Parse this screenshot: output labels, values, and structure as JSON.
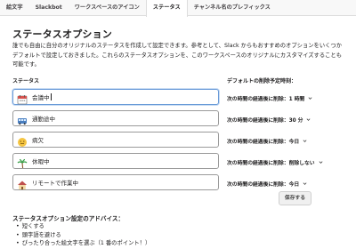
{
  "tabs": [
    "絵文字",
    "Slackbot",
    "ワークスペースのアイコン",
    "ステータス",
    "チャンネル名のプレフィックス"
  ],
  "page_title": "ステータスオプション",
  "description": "誰でも自由に自分のオリジナルのステータスを作成して設定できます。参考として、Slack からもおすすめのオプションをいくつかデフォルトで設定しておきました。これらのステータスオプションを、このワークスペースのオリジナルにカスタマイズすることも可能です。",
  "columns": {
    "status": "ステータス",
    "default_expiry": "デフォルトの削除予定時刻："
  },
  "expiry_prefix": "次の時間の経過後に削除：",
  "statuses": [
    {
      "emoji": "calendar-emoji",
      "text": "会議中",
      "expiry": "1 時間"
    },
    {
      "emoji": "bus-emoji",
      "text": "通勤途中",
      "expiry": "30 分"
    },
    {
      "emoji": "face-with-thermometer-emoji",
      "text": "病欠",
      "expiry": "今日"
    },
    {
      "emoji": "palm-tree-emoji",
      "text": "休暇中",
      "expiry": "削除しない"
    },
    {
      "emoji": "house-emoji",
      "text": "リモートで作業中",
      "expiry": "今日"
    }
  ],
  "save_label": "保存する",
  "advice": {
    "title": "ステータスオプション設定のアドバイス：",
    "items": [
      "短くする",
      "頭字語を避ける",
      "ぴったり合った絵文字を選ぶ（1 番のポイント！）"
    ]
  },
  "colors": {
    "focus": "#6a9bd8",
    "border": "#9a9a9a"
  }
}
